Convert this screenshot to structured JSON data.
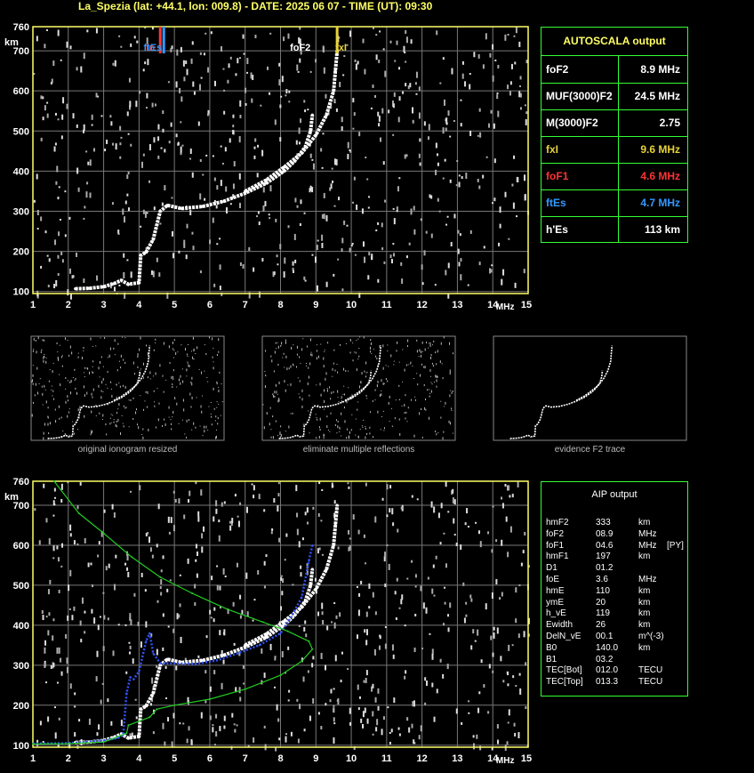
{
  "header": {
    "title": "La_Spezia (lat: +44.1, lon: 009.8) - DATE: 2025 06 07 - TIME (UT): 09:30"
  },
  "axes": {
    "y_ticks": [
      "760",
      "700",
      "600",
      "500",
      "400",
      "300",
      "200",
      "100"
    ],
    "y_unit": "km",
    "x_ticks": [
      "1",
      "2",
      "3",
      "4",
      "5",
      "6",
      "7",
      "8",
      "9",
      "10",
      "11",
      "12",
      "13",
      "14",
      "15"
    ],
    "x_unit": "MHz"
  },
  "markers": {
    "foF1": "fo",
    "ftEs": "ftEs",
    "foF2": "foF2",
    "fxI": "fxI"
  },
  "autoscala": {
    "title": "AUTOSCALA output",
    "rows": [
      {
        "name": "foF2",
        "value": "8.9 MHz",
        "color": "#ffffff"
      },
      {
        "name": "MUF(3000)F2",
        "value": "24.5 MHz",
        "color": "#ffffff"
      },
      {
        "name": "M(3000)F2",
        "value": "2.75",
        "color": "#ffffff"
      },
      {
        "name": "fxI",
        "value": "9.6 MHz",
        "color": "#e8d23a"
      },
      {
        "name": "foF1",
        "value": "4.6 MHz",
        "color": "#ff3333"
      },
      {
        "name": "ftEs",
        "value": "4.7 MHz",
        "color": "#3399ff"
      },
      {
        "name": "h'Es",
        "value": "113    km",
        "color": "#ffffff"
      }
    ]
  },
  "captions": {
    "thumb1": "original ionogram resized",
    "thumb2": "eliminate multiple reflections",
    "thumb3": "evidence F2 trace"
  },
  "aip": {
    "title": "AIP output",
    "rows": [
      {
        "name": "hmF2",
        "value": "333",
        "unit": "km",
        "extra": ""
      },
      {
        "name": "foF2",
        "value": "08.9",
        "unit": "MHz",
        "extra": ""
      },
      {
        "name": "foF1",
        "value": "04.6",
        "unit": "MHz",
        "extra": "[PY]"
      },
      {
        "name": "hmF1",
        "value": "197",
        "unit": "km",
        "extra": ""
      },
      {
        "name": "D1",
        "value": "01.2",
        "unit": "",
        "extra": ""
      },
      {
        "name": "foE",
        "value": "3.6",
        "unit": "MHz",
        "extra": ""
      },
      {
        "name": "hmE",
        "value": "110",
        "unit": "km",
        "extra": ""
      },
      {
        "name": "ymE",
        "value": "20",
        "unit": "km",
        "extra": ""
      },
      {
        "name": "h_vE",
        "value": "119",
        "unit": "km",
        "extra": ""
      },
      {
        "name": "Ewidth",
        "value": "26",
        "unit": "km",
        "extra": ""
      },
      {
        "name": "DelN_vE",
        "value": "00.1",
        "unit": "m^(-3)",
        "extra": ""
      },
      {
        "name": "B0",
        "value": "140.0",
        "unit": "km",
        "extra": ""
      },
      {
        "name": "B1",
        "value": "03.2",
        "unit": "",
        "extra": ""
      },
      {
        "name": "TEC[Bot]",
        "value": "012.0",
        "unit": "TECU",
        "extra": ""
      },
      {
        "name": "TEC[Top]",
        "value": "013.3",
        "unit": "TECU",
        "extra": ""
      }
    ]
  },
  "chart_data": [
    {
      "type": "scatter",
      "title": "",
      "xlabel": "MHz",
      "ylabel": "km",
      "xlim": [
        1,
        15
      ],
      "ylim": [
        95,
        760
      ],
      "grid": true,
      "markers": [
        {
          "name": "foF1",
          "x": 4.6,
          "color": "#ff3333"
        },
        {
          "name": "ftEs",
          "x": 4.7,
          "color": "#3399ff"
        },
        {
          "name": "foF2",
          "x": 8.9,
          "color": "#ffffff"
        },
        {
          "name": "fxI",
          "x": 9.6,
          "color": "#e8d23a"
        }
      ],
      "series": [
        {
          "color": "#ffffff",
          "points": [
            [
              2.2,
              107
            ],
            [
              2.6,
              108
            ],
            [
              3.0,
              112
            ],
            [
              3.3,
              120
            ],
            [
              3.5,
              128
            ],
            [
              3.7,
              118
            ],
            [
              4.0,
              122
            ],
            [
              4.05,
              190
            ],
            [
              4.2,
              198
            ],
            [
              4.4,
              230
            ],
            [
              4.6,
              300
            ],
            [
              4.8,
              315
            ],
            [
              5.2,
              307
            ],
            [
              5.8,
              312
            ],
            [
              6.4,
              325
            ],
            [
              7.0,
              345
            ],
            [
              7.6,
              370
            ],
            [
              8.1,
              400
            ],
            [
              8.4,
              425
            ],
            [
              8.7,
              460
            ],
            [
              8.85,
              500
            ],
            [
              8.9,
              540
            ]
          ]
        },
        {
          "color": "#ffffff",
          "points": [
            [
              7.0,
              350
            ],
            [
              7.6,
              378
            ],
            [
              8.1,
              410
            ],
            [
              8.6,
              445
            ],
            [
              9.0,
              490
            ],
            [
              9.3,
              540
            ],
            [
              9.5,
              600
            ],
            [
              9.55,
              650
            ],
            [
              9.6,
              700
            ]
          ]
        }
      ]
    },
    {
      "type": "line",
      "title": "",
      "xlabel": "MHz",
      "ylabel": "km",
      "xlim": [
        1,
        15
      ],
      "ylim": [
        95,
        760
      ],
      "grid": true,
      "series": [
        {
          "color": "#ffffff",
          "points": [
            [
              2.2,
              107
            ],
            [
              2.6,
              108
            ],
            [
              3.0,
              112
            ],
            [
              3.3,
              120
            ],
            [
              3.5,
              128
            ],
            [
              3.7,
              118
            ],
            [
              4.0,
              122
            ],
            [
              4.05,
              190
            ],
            [
              4.2,
              198
            ],
            [
              4.4,
              230
            ],
            [
              4.6,
              300
            ],
            [
              4.8,
              315
            ],
            [
              5.2,
              307
            ],
            [
              5.8,
              312
            ],
            [
              6.4,
              325
            ],
            [
              7.0,
              345
            ],
            [
              7.6,
              370
            ],
            [
              8.1,
              400
            ],
            [
              8.4,
              425
            ],
            [
              8.7,
              460
            ],
            [
              8.85,
              500
            ],
            [
              8.9,
              540
            ]
          ]
        },
        {
          "color": "#ffffff",
          "points": [
            [
              7.0,
              350
            ],
            [
              7.6,
              378
            ],
            [
              8.1,
              410
            ],
            [
              8.6,
              445
            ],
            [
              9.0,
              490
            ],
            [
              9.3,
              540
            ],
            [
              9.5,
              600
            ],
            [
              9.55,
              650
            ],
            [
              9.6,
              700
            ]
          ]
        },
        {
          "color": "#3355ff",
          "points": [
            [
              1.0,
              104
            ],
            [
              2.0,
              105
            ],
            [
              3.0,
              112
            ],
            [
              3.4,
              118
            ],
            [
              3.55,
              125
            ],
            [
              3.65,
              230
            ],
            [
              3.75,
              270
            ],
            [
              3.85,
              265
            ],
            [
              4.0,
              285
            ],
            [
              4.2,
              360
            ],
            [
              4.3,
              380
            ],
            [
              4.4,
              330
            ],
            [
              4.6,
              305
            ],
            [
              5.0,
              305
            ],
            [
              5.6,
              303
            ],
            [
              6.2,
              312
            ],
            [
              6.8,
              330
            ],
            [
              7.4,
              350
            ],
            [
              8.0,
              380
            ],
            [
              8.3,
              420
            ],
            [
              8.6,
              470
            ],
            [
              8.8,
              560
            ],
            [
              8.9,
              600
            ]
          ]
        },
        {
          "color": "#22cc22",
          "points": [
            [
              1.0,
              103
            ],
            [
              2.0,
              104
            ],
            [
              3.0,
              108
            ],
            [
              3.5,
              125
            ],
            [
              3.65,
              130
            ],
            [
              3.7,
              150
            ],
            [
              4.3,
              170
            ],
            [
              4.5,
              190
            ],
            [
              5.0,
              200
            ],
            [
              6.0,
              215
            ],
            [
              7.0,
              240
            ],
            [
              8.0,
              275
            ],
            [
              8.6,
              310
            ],
            [
              8.9,
              340
            ],
            [
              8.8,
              360
            ],
            [
              8.2,
              385
            ],
            [
              7.5,
              408
            ],
            [
              6.5,
              440
            ],
            [
              5.5,
              480
            ],
            [
              4.6,
              520
            ],
            [
              3.8,
              570
            ],
            [
              3.0,
              630
            ],
            [
              2.3,
              680
            ],
            [
              1.6,
              760
            ]
          ]
        }
      ]
    }
  ]
}
